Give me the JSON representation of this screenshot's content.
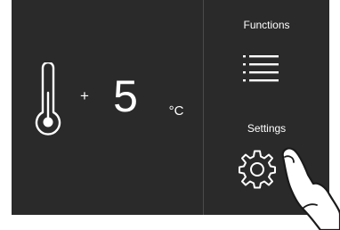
{
  "display": {
    "thermometer_icon": "thermometer-icon",
    "sign": "+",
    "temperature": "5",
    "unit": "°C"
  },
  "side_menu": {
    "functions_label": "Functions",
    "functions_icon": "menu-lines-icon",
    "settings_label": "Settings",
    "settings_icon": "gear-icon"
  },
  "overlay": {
    "hand_icon": "pointing-finger-icon"
  },
  "colors": {
    "panel_bg": "#2a2a2a",
    "divider": "#4a4a4a",
    "foreground": "#ffffff",
    "page_bg": "#ffffff"
  }
}
